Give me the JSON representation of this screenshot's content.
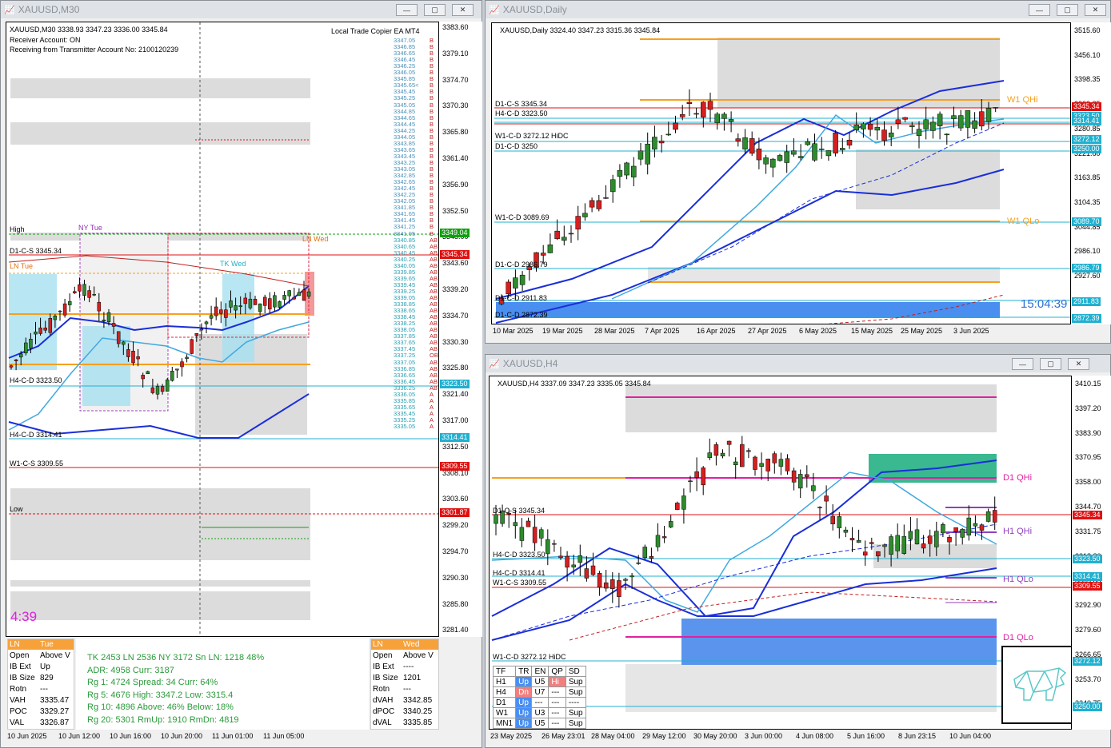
{
  "m30": {
    "title": "XAUUSD,M30",
    "info": "XAUUSD,M30  3338.93 3347.23 3336.00 3345.84",
    "ea": "Local Trade Copier EA MT4",
    "receiver": "Receiver Account: ON",
    "receiving": "Receiving from Transmitter Account No: 2100120239",
    "prices": [
      "3383.60",
      "3379.10",
      "3374.70",
      "3370.30",
      "3365.80",
      "3361.40",
      "3356.90",
      "3352.50",
      "3348.00",
      "3343.60",
      "3339.20",
      "3334.70",
      "3330.30",
      "3325.80",
      "3321.40",
      "3317.00",
      "3312.50",
      "3308.10",
      "3303.60",
      "3299.20",
      "3294.70",
      "3290.30",
      "3285.80",
      "3281.40"
    ],
    "price_tags": [
      {
        "v": "3349.04",
        "c": "#10a010"
      },
      {
        "v": "3345.34",
        "c": "#e01010"
      },
      {
        "v": "3323.50",
        "c": "#20b0d0"
      },
      {
        "v": "3314.41",
        "c": "#20b0d0"
      },
      {
        "v": "3309.55",
        "c": "#e01010"
      },
      {
        "v": "3301.87",
        "c": "#e01010"
      }
    ],
    "levels": [
      "High",
      "NY Tue",
      "D1-C-S 3345.34",
      "LN Wed",
      "LN Tue",
      "TK Wed",
      "H4-C-D 3323.50",
      "H4-C-D 3314.41",
      "W1-C-S 3309.55",
      "Low"
    ],
    "timer": "4:39",
    "times": [
      "10 Jun 2025",
      "10 Jun 12:00",
      "10 Jun 16:00",
      "10 Jun 20:00",
      "11 Jun 01:00",
      "11 Jun 05:00"
    ],
    "ladder": [
      "3347.05",
      "3346.85",
      "3346.65",
      "3346.45",
      "3346.25",
      "3346.05",
      "3345.85",
      "3345.65<",
      "3345.45",
      "3345.25",
      "3345.05",
      "3344.85",
      "3344.65",
      "3344.45",
      "3344.25",
      "3344.05",
      "3343.85",
      "3343.65",
      "3343.45",
      "3343.25",
      "3343.05",
      "3342.85",
      "3342.65",
      "3342.45",
      "3342.25",
      "3342.05",
      "3341.85",
      "3341.65",
      "3341.45",
      "3341.25",
      "3341.05",
      "3340.85",
      "3340.65",
      "3340.45",
      "3340.25",
      "3340.05",
      "3339.85",
      "3339.65",
      "3339.45",
      "3339.25",
      "3339.05",
      "3338.85",
      "3338.65",
      "3338.45",
      "3338.25",
      "3338.05",
      "3337.85",
      "3337.65",
      "3337.45",
      "3337.25",
      "3337.05",
      "3336.85",
      "3336.65",
      "3336.45",
      "3336.25",
      "3336.05",
      "3335.85",
      "3335.65",
      "3335.45",
      "3335.25",
      "3335.05"
    ],
    "ladder_tags": [
      "B",
      "B",
      "B",
      "B",
      "B",
      "B",
      "B",
      "B",
      "B",
      "B",
      "B",
      "B",
      "B",
      "B",
      "B",
      "B",
      "B",
      "B",
      "B",
      "B",
      "B",
      "B",
      "B",
      "B",
      "B",
      "B",
      "B",
      "B",
      "B",
      "B",
      "B",
      "AB",
      "AB",
      "AB",
      "AB",
      "AB",
      "AB",
      "AB",
      "AB",
      "AB",
      "AB",
      "AB",
      "AB",
      "AB",
      "AB",
      "AB",
      "AB",
      "AB",
      "AB",
      "OB",
      "AB",
      "AB",
      "AB",
      "AB",
      "AB",
      "A",
      "A",
      "A",
      "A",
      "A",
      "A"
    ],
    "tue": {
      "h1": "LN",
      "h2": "Tue",
      "rows": [
        [
          "Open",
          "Above V"
        ],
        [
          "IB Ext",
          "Up"
        ],
        [
          "IB Size",
          "829"
        ],
        [
          "Rotn",
          "---"
        ],
        [
          "VAH",
          "3335.47"
        ],
        [
          "POC",
          "3329.27"
        ],
        [
          "VAL",
          "3326.87"
        ]
      ]
    },
    "wed": {
      "h1": "LN",
      "h2": "Wed",
      "rows": [
        [
          "Open",
          "Above V"
        ],
        [
          "IB Ext",
          "----"
        ],
        [
          "IB Size",
          "1201"
        ],
        [
          "Rotn",
          "---"
        ],
        [
          "dVAH",
          "3342.85"
        ],
        [
          "dPOC",
          "3340.25"
        ],
        [
          "dVAL",
          "3335.85"
        ]
      ]
    },
    "stats": [
      "TK  2453  LN  2536  NY  3172     Sn LN: 1218   48%",
      "ADR:   4958     Curr:    3187",
      "Rg  1:   4724   Spread:  34      Curr:    64%",
      "Rg  5:   4676   High:  3347.2   Low:    3315.4",
      "Rg 10:  4896   Above:   46%    Below:   18%",
      "Rg 20:  5301   RmUp: 1910    RmDn:  4819"
    ]
  },
  "daily": {
    "title": "XAUUSD,Daily",
    "info": "XAUUSD,Daily  3324.40 3347.23 3315.36 3345.84",
    "prices": [
      "3515.60",
      "3456.10",
      "3398.35",
      "3338.85",
      "3280.85",
      "3221.60",
      "3163.85",
      "3104.35",
      "3044.85",
      "2986.10",
      "2927.60",
      "2868.10"
    ],
    "price_tags": [
      {
        "v": "3345.34",
        "c": "#e01010"
      },
      {
        "v": "3323.50",
        "c": "#20b0d0"
      },
      {
        "v": "3314.41",
        "c": "#20b0d0"
      },
      {
        "v": "3272.12",
        "c": "#20b0d0"
      },
      {
        "v": "3250.00",
        "c": "#20b0d0"
      },
      {
        "v": "3089.70",
        "c": "#20b0d0"
      },
      {
        "v": "2986.79",
        "c": "#20b0d0"
      },
      {
        "v": "2911.83",
        "c": "#20b0d0"
      },
      {
        "v": "2872.39",
        "c": "#20b0d0"
      }
    ],
    "levels": [
      "D1-C-S 3345.34",
      "H4-C-D 3323.50",
      "H4-C-D 3314.41",
      "W1-C-D 3272.12 HiDC",
      "D1-C-D 3250",
      "W1-C-D 3089.69",
      "D1-C-D 2986.79",
      "D1-C-D 2911.83",
      "D1-C-D 2872.39",
      "W1 QHi",
      "W1 QLo"
    ],
    "clock": "15:04:39",
    "times": [
      "10 Mar 2025",
      "19 Mar 2025",
      "28 Mar 2025",
      "7 Apr 2025",
      "16 Apr 2025",
      "27 Apr 2025",
      "6 May 2025",
      "15 May 2025",
      "25 May 2025",
      "3 Jun 2025"
    ]
  },
  "h4": {
    "title": "XAUUSD,H4",
    "info": "XAUUSD,H4  3337.09 3347.23 3335.05 3345.84",
    "prices": [
      "3410.15",
      "3397.20",
      "3383.90",
      "3370.95",
      "3358.00",
      "3344.70",
      "3331.75",
      "3318.80",
      "3305.85",
      "3292.90",
      "3279.60",
      "3266.65",
      "3253.70",
      "3240.75"
    ],
    "price_tags": [
      {
        "v": "3345.34",
        "c": "#e01010"
      },
      {
        "v": "3323.50",
        "c": "#20b0d0"
      },
      {
        "v": "3314.41",
        "c": "#20b0d0"
      },
      {
        "v": "3309.55",
        "c": "#e01010"
      },
      {
        "v": "3272.12",
        "c": "#20b0d0"
      },
      {
        "v": "3250.00",
        "c": "#20b0d0"
      }
    ],
    "levels": [
      "D1-C-S 3345.34",
      "H4-C-D 3323.50",
      "H4-C-D 3314.41",
      "W1-C-S 3309.55",
      "W1-C-D 3272.12 HiDC",
      "D1 QHi",
      "H1 QHi",
      "H1 QLo",
      "D1 QLo"
    ],
    "times": [
      "23 May 2025",
      "26 May 23:01",
      "28 May 04:00",
      "29 May 12:00",
      "30 May 20:00",
      "3 Jun 00:00",
      "4 Jun 08:00",
      "5 Jun 16:00",
      "8 Jun 23:15",
      "10 Jun 04:00"
    ],
    "trend_header": [
      "TF",
      "TR",
      "EN",
      "QP",
      "SD"
    ],
    "trend_rows": [
      [
        "H1",
        "Up",
        "U5",
        "Hi",
        "Sup"
      ],
      [
        "H4",
        "Dn",
        "U7",
        "---",
        "Sup"
      ],
      [
        "D1",
        "Up",
        "---",
        "---",
        "----"
      ],
      [
        "W1",
        "Up",
        "U3",
        "---",
        "Sup"
      ],
      [
        "MN1",
        "Up",
        "U5",
        "---",
        "Sup"
      ]
    ]
  },
  "colors": {
    "up": "#2e8b2e",
    "down": "#d42020",
    "orange": "#f5a020",
    "magenta": "#e020a0",
    "blue": "#1a2ed8",
    "cyan": "#40a8e0",
    "accent": "#f7a13a"
  }
}
